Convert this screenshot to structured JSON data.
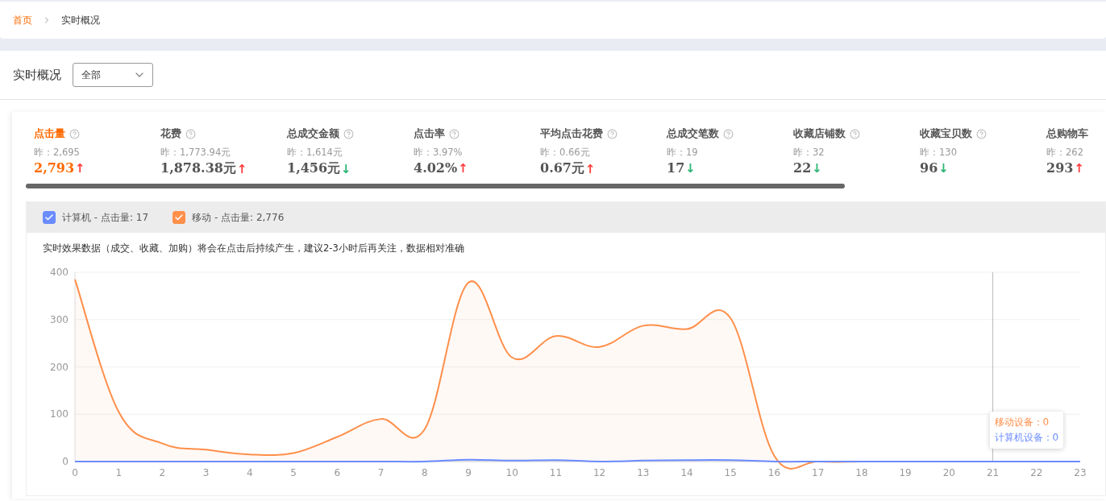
{
  "breadcrumb": [
    {
      "label": "首页",
      "link": true
    },
    {
      "label": "实时概况",
      "link": false
    }
  ],
  "header": {
    "title": "实时概况",
    "select": {
      "value": "全部"
    }
  },
  "metrics": [
    {
      "label": "点击量",
      "help": true,
      "yesterday": "昨：2,695",
      "value": "2,793",
      "trend": "↑",
      "color": "#ff3b3b",
      "selected": true
    },
    {
      "label": "花费",
      "help": true,
      "yesterday": "昨：1,773.94元",
      "value": "1,878.38元",
      "trend": "↑",
      "color": "#ff3b3b",
      "selected": false
    },
    {
      "label": "总成交金额",
      "help": true,
      "yesterday": "昨：1,614元",
      "value": "1,456元",
      "trend": "↓",
      "color": "#2bb673",
      "selected": false
    },
    {
      "label": "点击率",
      "help": true,
      "yesterday": "昨：3.97%",
      "value": "4.02%",
      "trend": "↑",
      "color": "#ff3b3b",
      "selected": false
    },
    {
      "label": "平均点击花费",
      "help": true,
      "yesterday": "昨：0.66元",
      "value": "0.67元",
      "trend": "↑",
      "color": "#ff3b3b",
      "selected": false
    },
    {
      "label": "总成交笔数",
      "help": true,
      "yesterday": "昨：19",
      "value": "17",
      "trend": "↓",
      "color": "#2bb673",
      "selected": false
    },
    {
      "label": "收藏店铺数",
      "help": true,
      "yesterday": "昨：32",
      "value": "22",
      "trend": "↓",
      "color": "#2bb673",
      "selected": false
    },
    {
      "label": "收藏宝贝数",
      "help": true,
      "yesterday": "昨：130",
      "value": "96",
      "trend": "↓",
      "color": "#2bb673",
      "selected": false
    },
    {
      "label": "总购物车",
      "help": false,
      "yesterday": "昨：262",
      "value": "293",
      "trend": "↑",
      "color": "#ff3b3b",
      "selected": false
    }
  ],
  "legend": [
    {
      "count": "- 点击量: 17",
      "checked": true
    },
    {
      "count": "- 点击量: 2,776",
      "checked": true
    }
  ],
  "notice": "实时效果数据（成交、收藏、加购）将会在点击后持续产生，建议2-3小时后再关注，数据相对准确",
  "chart_data": {
    "type": "area",
    "x": [
      0,
      1,
      2,
      3,
      4,
      5,
      6,
      7,
      8,
      9,
      10,
      11,
      12,
      13,
      14,
      15,
      16,
      17,
      18,
      19,
      20,
      21,
      22,
      23
    ],
    "xlim": [
      0,
      23
    ],
    "ylim": [
      0,
      400
    ],
    "yticks": [
      0,
      100,
      200,
      300,
      400
    ],
    "xticks": [
      0,
      1,
      2,
      3,
      4,
      5,
      6,
      7,
      8,
      9,
      10,
      11,
      12,
      13,
      14,
      15,
      16,
      17,
      18,
      19,
      20,
      21,
      22,
      23
    ],
    "grid": true,
    "ref_lines": [
      {
        "axis": "x",
        "value": 21
      }
    ],
    "series": [
      {
        "name": "计算机",
        "color": "#6b8cff",
        "values": [
          0,
          0,
          0,
          0,
          0,
          0,
          0,
          0,
          0,
          4,
          2,
          3,
          0,
          2,
          3,
          3,
          0,
          0,
          0,
          0,
          0,
          0,
          0,
          0
        ]
      },
      {
        "name": "移动",
        "color": "#ff8f4a",
        "values": [
          385,
          105,
          38,
          25,
          15,
          18,
          52,
          90,
          68,
          378,
          220,
          265,
          242,
          287,
          280,
          303,
          12,
          0,
          0,
          0,
          0,
          0,
          0,
          0
        ]
      }
    ]
  },
  "tooltip": {
    "lines": [
      {
        "label": "移动设备：0",
        "color": "#ff8f4a"
      },
      {
        "label": "计算机设备：0",
        "color": "#6b8cff"
      }
    ]
  }
}
